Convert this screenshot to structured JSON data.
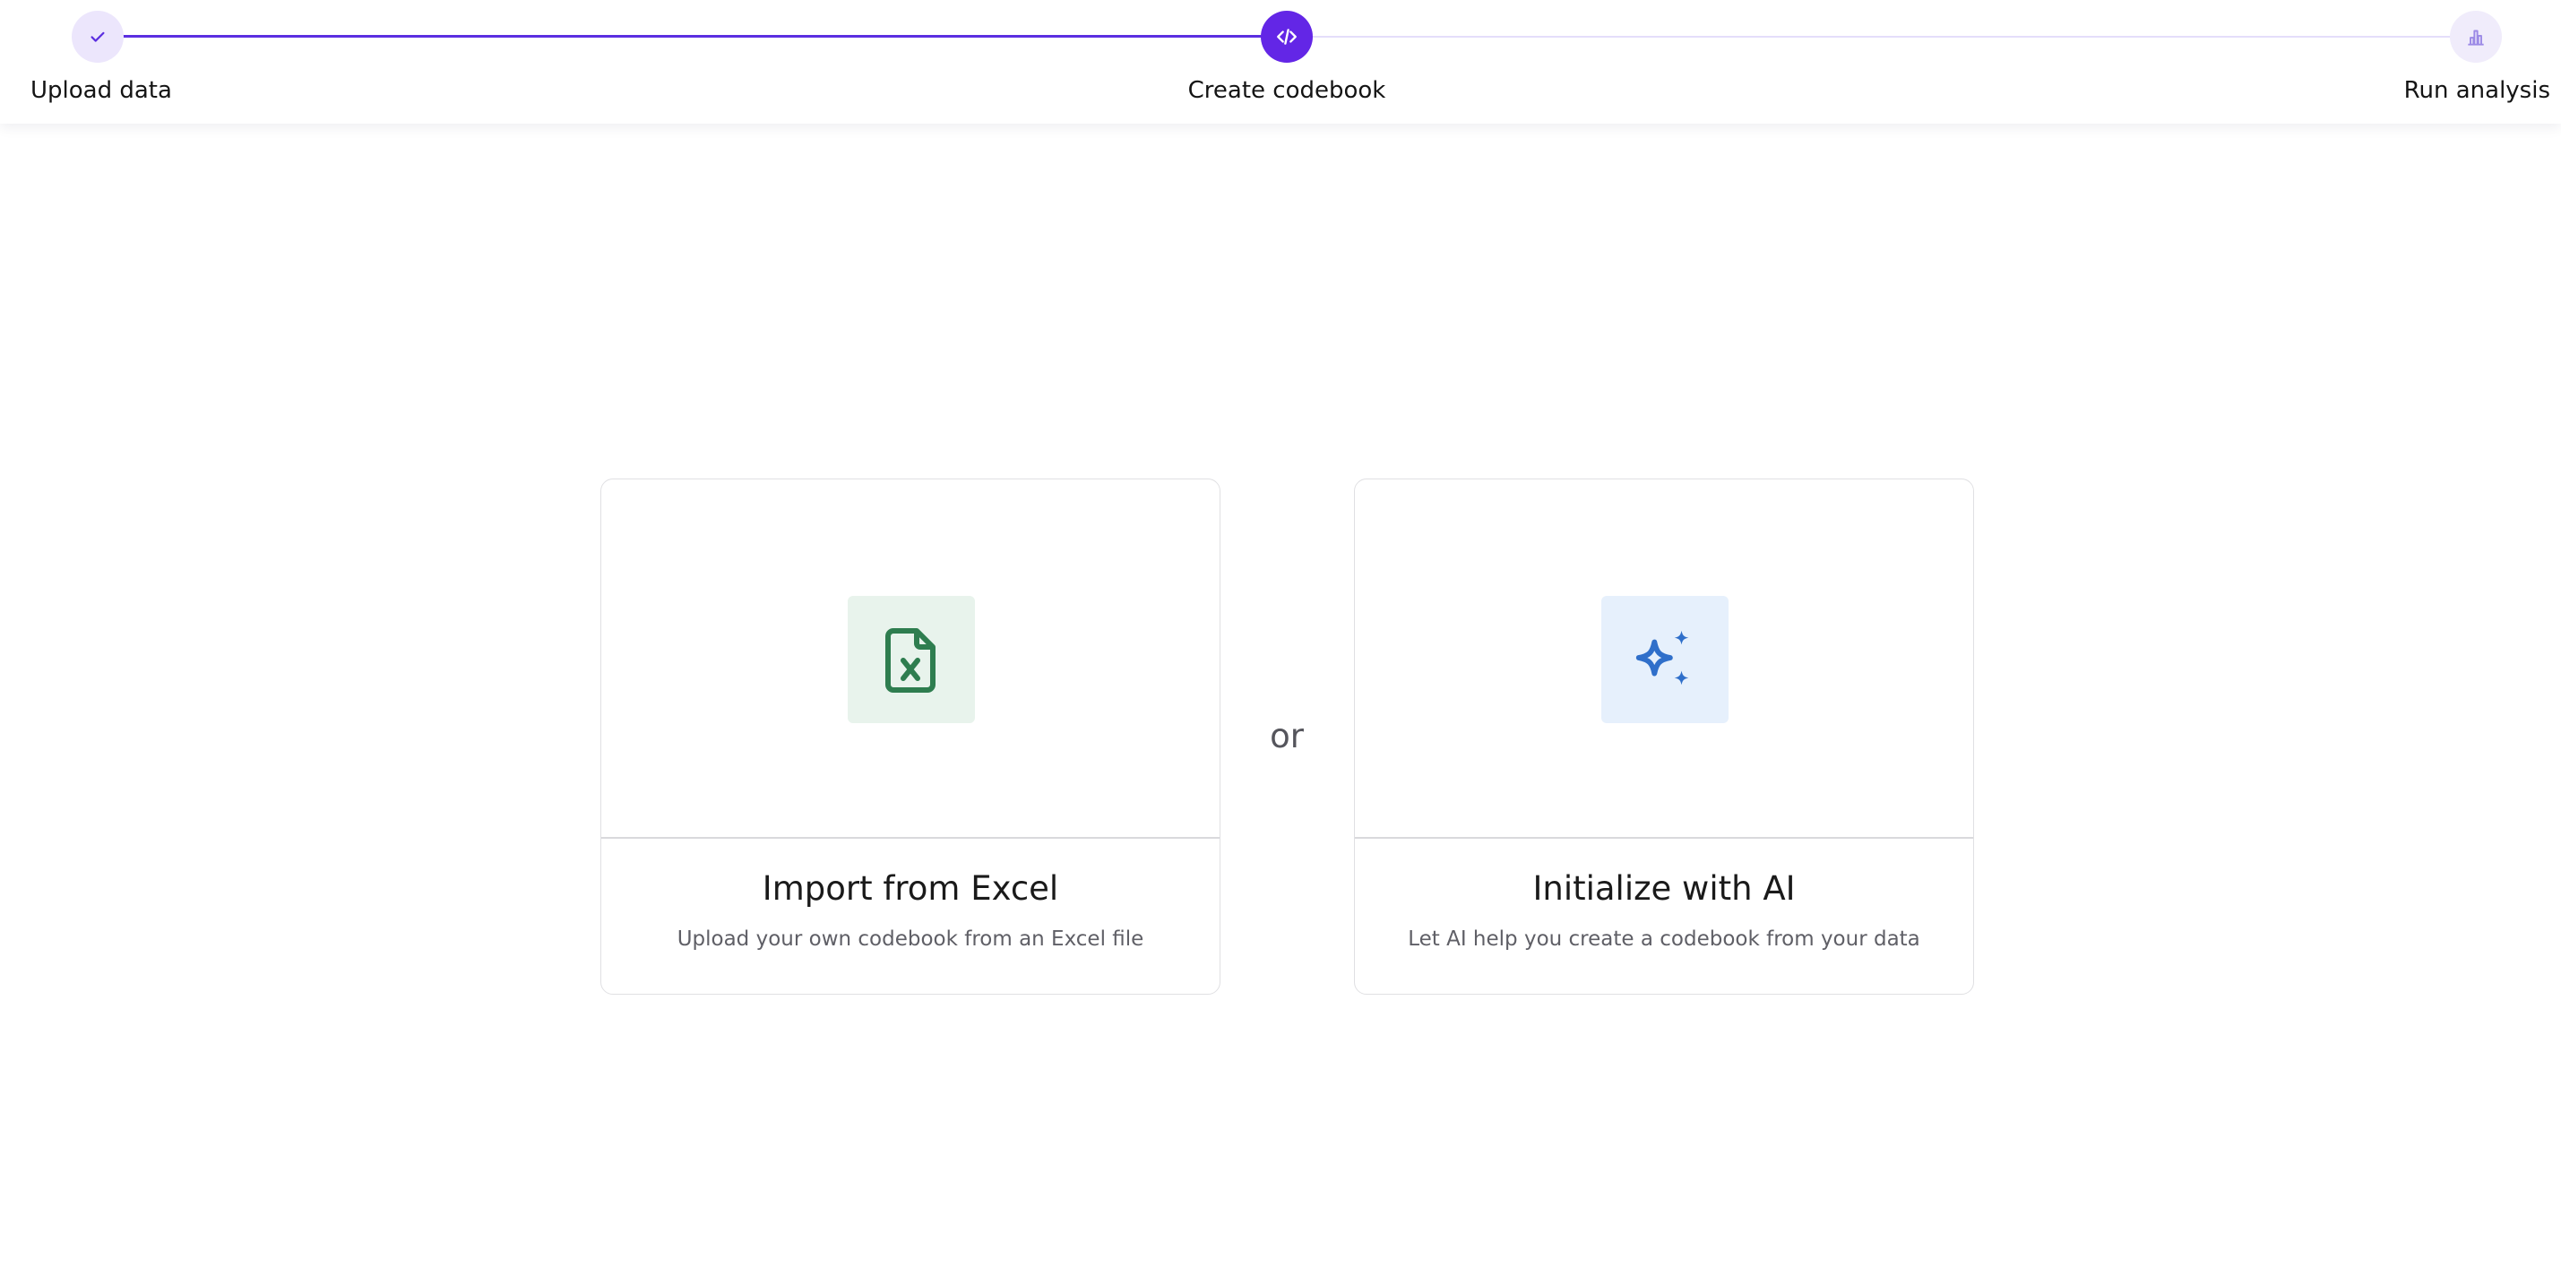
{
  "stepper": {
    "steps": [
      {
        "label": "Upload data",
        "status": "completed",
        "icon": "check-icon"
      },
      {
        "label": "Create codebook",
        "status": "active",
        "icon": "code-icon"
      },
      {
        "label": "Run analysis",
        "status": "pending",
        "icon": "bar-chart-icon"
      }
    ]
  },
  "options": {
    "excel": {
      "title": "Import from Excel",
      "description": "Upload your own codebook from an Excel file",
      "icon": "excel-file-icon",
      "accent": "#2e7d4f"
    },
    "separator": "or",
    "ai": {
      "title": "Initialize with AI",
      "description": "Let AI help you create a codebook from your data",
      "icon": "sparkles-icon",
      "accent": "#2f6fca"
    }
  },
  "colors": {
    "primary": "#6326e6",
    "track_done": "#5b2ee0",
    "track_todo": "#e4defa"
  }
}
